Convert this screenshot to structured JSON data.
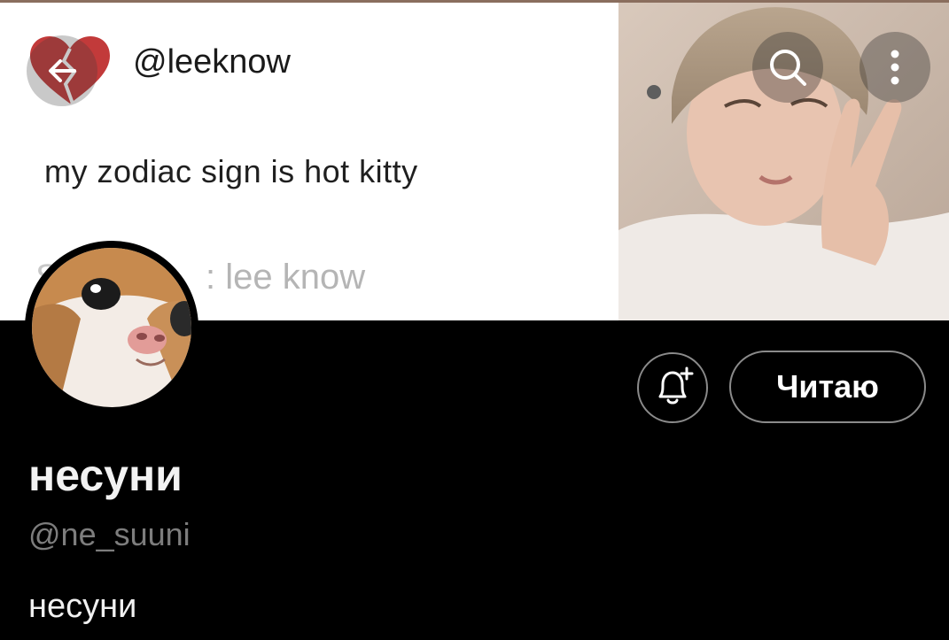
{
  "banner": {
    "tweet_handle": "@leeknow",
    "tweet_text": "my zodiac sign is hot kitty",
    "tweet_source_prefix": "S",
    "tweet_source": ": lee know",
    "back_icon": "arrow-left-icon",
    "search_icon": "search-icon",
    "more_icon": "more-vertical-icon"
  },
  "profile": {
    "display_name": "несуни",
    "handle": "@ne_suuni",
    "bio": "несуни",
    "follow_label": "Читаю",
    "bell_icon": "bell-plus-icon"
  }
}
